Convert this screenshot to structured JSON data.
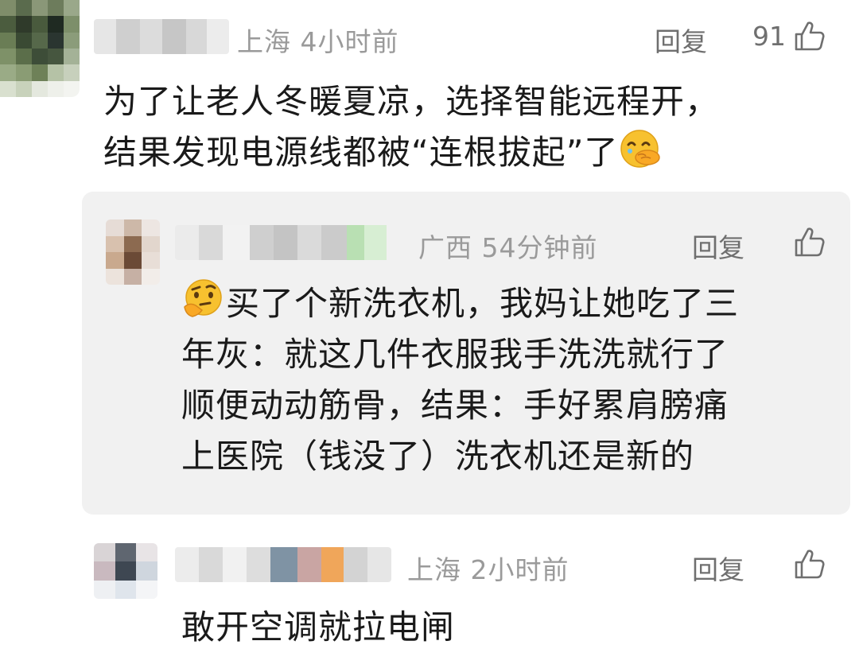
{
  "colors": {
    "meta": "#9a9a9a",
    "text": "#1a1a1a",
    "reply_bg": "#f1f1f1",
    "emoji": "#f7c12f"
  },
  "comments": [
    {
      "location": "上海",
      "time": "4小时前",
      "reply_label": "回复",
      "likes": "91",
      "lines": [
        "为了让老人冬暖夏凉，选择智能远程开，",
        "结果发现电源线都被“连根拔起”了"
      ],
      "trailing_emoji": "face-with-hand-over-mouth-icon"
    },
    {
      "location": "广西",
      "time": "54分钟前",
      "reply_label": "回复",
      "leading_emoji": "thinking-face-icon",
      "lines": [
        "买了个新洗衣机，我妈让她吃了三",
        "年灰：就这几件衣服我手洗洗就行了",
        "顺便动动筋骨，结果：手好累肩膀痛",
        "上医院（钱没了）洗衣机还是新的"
      ]
    },
    {
      "location": "上海",
      "time": "2小时前",
      "reply_label": "回复",
      "lines": [
        "敢开空调就拉电闸"
      ]
    }
  ]
}
